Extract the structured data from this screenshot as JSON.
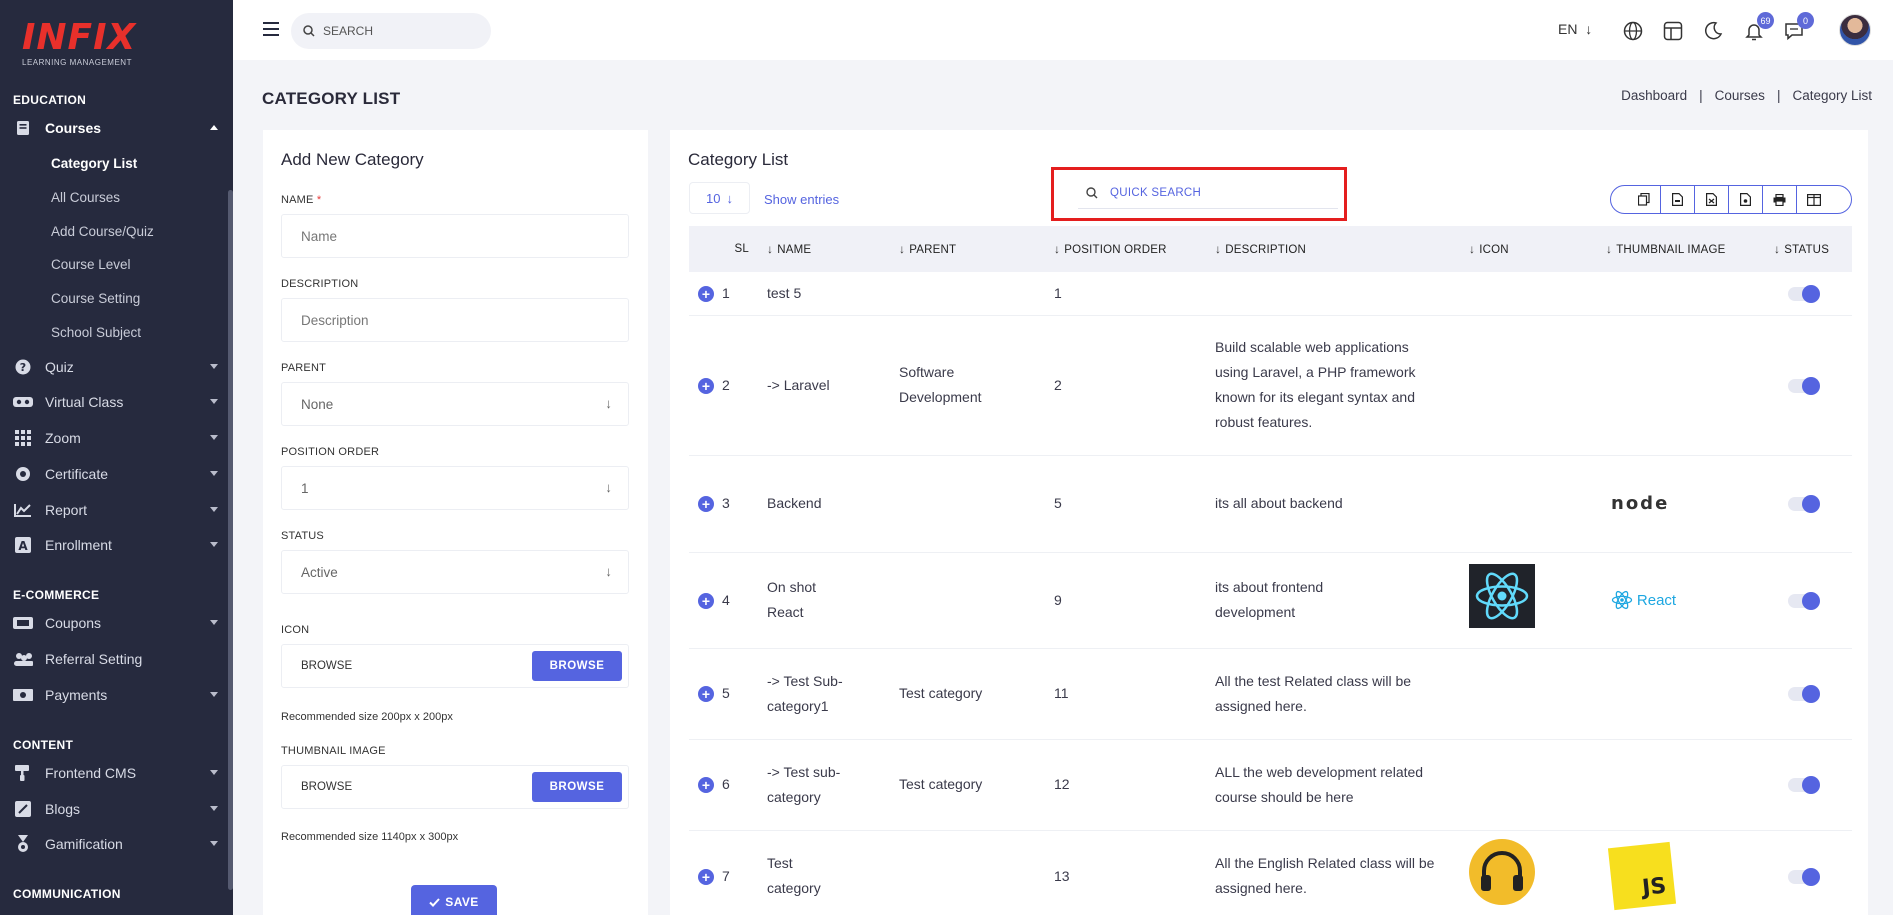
{
  "app": {
    "logo_text": "INFIX",
    "logo_sub": "LEARNING MANAGEMENT"
  },
  "sidebar": {
    "sections": {
      "education": "EDUCATION",
      "ecommerce": "E-COMMERCE",
      "content": "CONTENT",
      "communication": "COMMUNICATION"
    },
    "courses": "Courses",
    "sub": [
      "Category List",
      "All Courses",
      "Add Course/Quiz",
      "Course Level",
      "Course Setting",
      "School Subject"
    ],
    "items": {
      "quiz": "Quiz",
      "virtual_class": "Virtual Class",
      "zoom": "Zoom",
      "certificate": "Certificate",
      "report": "Report",
      "enrollment": "Enrollment",
      "coupons": "Coupons",
      "referral": "Referral Setting",
      "payments": "Payments",
      "frontend_cms": "Frontend CMS",
      "blogs": "Blogs",
      "gamification": "Gamification"
    }
  },
  "topbar": {
    "search_placeholder": "SEARCH",
    "lang": "EN",
    "notif_count": "69",
    "msg_count": "0"
  },
  "page": {
    "title": "CATEGORY LIST",
    "breadcrumb": [
      "Dashboard",
      "Courses",
      "Category List"
    ]
  },
  "form": {
    "heading": "Add New Category",
    "name_label": "NAME",
    "name_placeholder": "Name",
    "description_label": "DESCRIPTION",
    "description_placeholder": "Description",
    "parent_label": "PARENT",
    "parent_value": "None",
    "position_label": "POSITION ORDER",
    "position_value": "1",
    "status_label": "STATUS",
    "status_value": "Active",
    "icon_label": "ICON",
    "icon_file": "BROWSE",
    "icon_btn": "BROWSE",
    "icon_hint": "Recommended size 200px x 200px",
    "thumb_label": "THUMBNAIL IMAGE",
    "thumb_file": "BROWSE",
    "thumb_btn": "BROWSE",
    "thumb_hint": "Recommended size 1140px x 300px",
    "save": "SAVE"
  },
  "list": {
    "heading": "Category List",
    "entries": "10",
    "show_entries": "Show entries",
    "quick_search_placeholder": "QUICK SEARCH",
    "columns": [
      "SL",
      "NAME",
      "PARENT",
      "POSITION ORDER",
      "DESCRIPTION",
      "ICON",
      "THUMBNAIL IMAGE",
      "STATUS"
    ],
    "rows": [
      {
        "sl": "1",
        "name": "test 5",
        "parent": "",
        "position": "1",
        "description": "",
        "icon": "",
        "thumb": ""
      },
      {
        "sl": "2",
        "name": "-> Laravel",
        "parent": "Software Development",
        "position": "2",
        "description": "Build scalable web applications using Laravel, a PHP framework known for its elegant syntax and robust features.",
        "icon": "",
        "thumb": ""
      },
      {
        "sl": "3",
        "name": "Backend",
        "parent": "",
        "position": "5",
        "description": "its all about backend",
        "icon": "",
        "thumb": "node"
      },
      {
        "sl": "4",
        "name": "On shot React",
        "parent": "",
        "position": "9",
        "description": "its about frontend development",
        "icon": "react-atom",
        "thumb": "React"
      },
      {
        "sl": "5",
        "name": "-> Test Sub-category1",
        "parent": "Test category",
        "position": "11",
        "description": "All the test Related class will be assigned here.",
        "icon": "",
        "thumb": ""
      },
      {
        "sl": "6",
        "name": "-> Test sub-category",
        "parent": "Test category",
        "position": "12",
        "description": "ALL the web development related course should be here",
        "icon": "",
        "thumb": ""
      },
      {
        "sl": "7",
        "name": "Test category",
        "parent": "",
        "position": "13",
        "description": "All the English Related class will be assigned here.",
        "icon": "headphones",
        "thumb": "JS"
      }
    ]
  },
  "colors": {
    "accent": "#5564e0",
    "sidebar_bg": "#262a3e",
    "highlight": "#e41e1e"
  }
}
